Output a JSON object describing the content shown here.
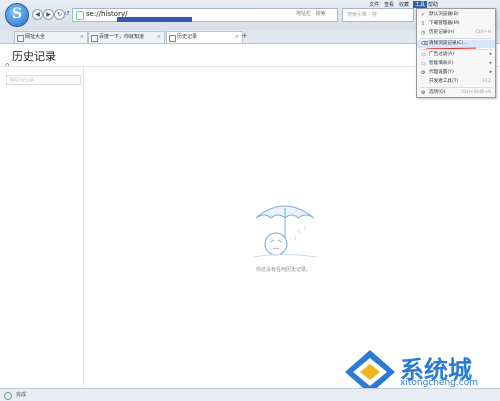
{
  "browser": {
    "address_url": "se://history/",
    "address_right": "地址栏 · 搜索",
    "search_placeholder": "搜索引擎 · 搜",
    "top_menu": [
      "文件",
      "查看",
      "收藏",
      "工具",
      "帮助"
    ],
    "nav_button_glyphs": [
      "◀",
      "▶",
      "↻",
      "↺"
    ]
  },
  "tabs": [
    {
      "label": "网址大全"
    },
    {
      "label": "百度一下，你就知道"
    },
    {
      "label": "历史记录"
    }
  ],
  "new_tab_glyph": "+",
  "page": {
    "title": "历史记录",
    "sidebar_search_placeholder": "搜索历史记录",
    "empty_text": "你还没有任何历史记录。"
  },
  "tools_menu": {
    "items": [
      {
        "label": "默认浏览器(B)",
        "icon": "✓"
      },
      {
        "label": "下载管理器(M)",
        "icon": "⇩"
      },
      {
        "label": "历史记录(H)",
        "icon": "◷",
        "shortcut": "Ctrl+H"
      },
      {
        "label": "清除浏览记录(C)...",
        "icon": "⌫",
        "shortcut": "Ctrl+Shift+Del",
        "highlighted": true
      },
      {
        "label": "广告过滤(A)",
        "icon": "▭",
        "submenu": true
      },
      {
        "label": "智能填表(F)",
        "icon": "▭",
        "submenu": true
      },
      {
        "label": "代理设置(Y)",
        "icon": "⚙",
        "submenu": true
      },
      {
        "label": "开发者工具(T)",
        "shortcut": "F12"
      },
      {
        "label": "选项(O)",
        "icon": "⚙",
        "shortcut": "Ctrl+Shift+S"
      }
    ]
  },
  "status": {
    "text": "完成"
  },
  "watermark": {
    "title": "系统城",
    "site": "xitongcheng.com"
  },
  "colors": {
    "accent": "#2f5fa8",
    "watermark": "#2a7bd6"
  }
}
